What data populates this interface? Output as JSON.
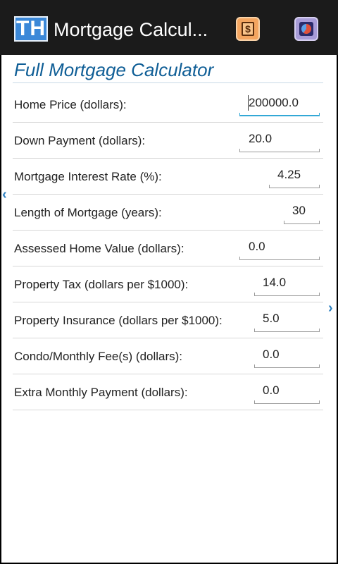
{
  "app": {
    "icon_text": "TH",
    "title": "Mortgage Calcul...",
    "actions": [
      {
        "name": "loan-summary",
        "glyph": "$",
        "icon": "dollar-icon"
      },
      {
        "name": "chart",
        "icon": "pie-chart-icon"
      }
    ]
  },
  "calculator": {
    "title": "Full Mortgage Calculator",
    "fields": [
      {
        "label": "Home Price (dollars):",
        "value": "200000.0"
      },
      {
        "label": "Down Payment (dollars):",
        "value": "20.0"
      },
      {
        "label": "Mortgage Interest Rate (%):",
        "value": "4.25"
      },
      {
        "label": "Length of Mortgage (years):",
        "value": "30"
      },
      {
        "label": "Assessed Home Value (dollars):",
        "value": "0.0"
      },
      {
        "label": "Property Tax (dollars per $1000):",
        "value": "14.0"
      },
      {
        "label": "Property Insurance (dollars per $1000):",
        "value": "5.0"
      },
      {
        "label": "Condo/Monthly Fee(s) (dollars):",
        "value": "0.0"
      },
      {
        "label": "Extra Monthly Payment (dollars):",
        "value": "0.0"
      }
    ]
  },
  "nav": {
    "prev_glyph": "‹",
    "next_glyph": "›"
  },
  "colors": {
    "actionbar": "#1b1b1b",
    "title": "#0f5e96",
    "focus": "#33a8d6"
  }
}
